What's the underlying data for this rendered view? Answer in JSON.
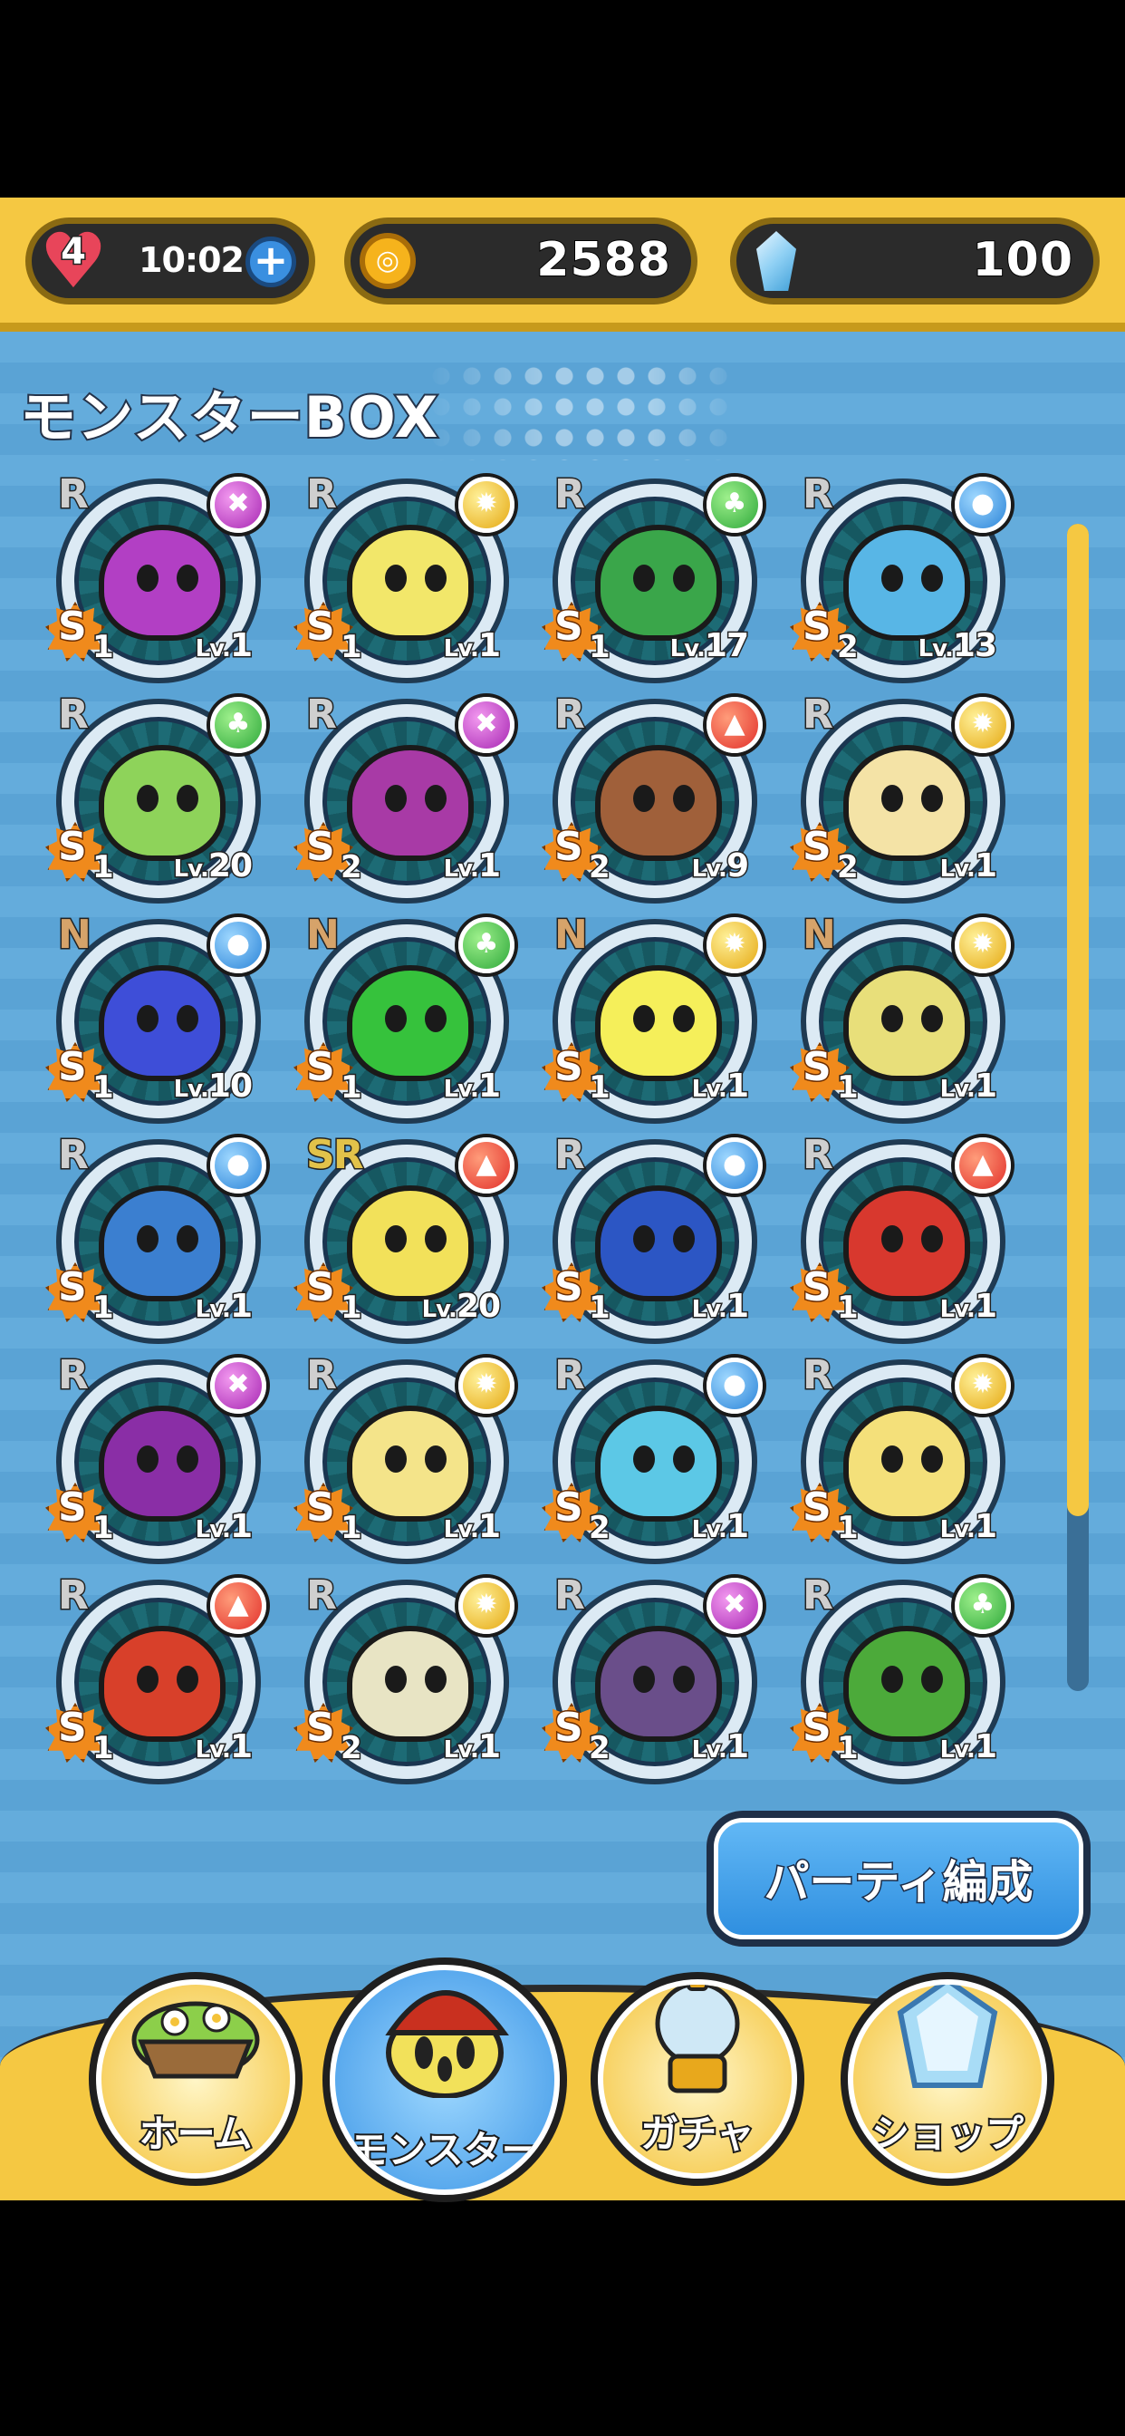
{
  "header": {
    "life_count": "4",
    "timer": "10:02",
    "coins": "2588",
    "gems": "100"
  },
  "box_title": "モンスターBOX",
  "monsters": [
    {
      "rarity": "R",
      "element": "dark",
      "stars": "1",
      "lv": "1",
      "color": "#b23fc4"
    },
    {
      "rarity": "R",
      "element": "light",
      "stars": "1",
      "lv": "1",
      "color": "#f2e76a"
    },
    {
      "rarity": "R",
      "element": "wood",
      "stars": "1",
      "lv": "17",
      "color": "#3aa64a"
    },
    {
      "rarity": "R",
      "element": "water",
      "stars": "2",
      "lv": "13",
      "color": "#58b6e6"
    },
    {
      "rarity": "R",
      "element": "wood",
      "stars": "1",
      "lv": "20",
      "color": "#8ed35a"
    },
    {
      "rarity": "R",
      "element": "dark",
      "stars": "2",
      "lv": "1",
      "color": "#a83aa6"
    },
    {
      "rarity": "R",
      "element": "fire",
      "stars": "2",
      "lv": "9",
      "color": "#a0603a"
    },
    {
      "rarity": "R",
      "element": "light",
      "stars": "2",
      "lv": "1",
      "color": "#f4e3a6"
    },
    {
      "rarity": "N",
      "element": "water",
      "stars": "1",
      "lv": "10",
      "color": "#3e4ed8"
    },
    {
      "rarity": "N",
      "element": "wood",
      "stars": "1",
      "lv": "1",
      "color": "#36c23c"
    },
    {
      "rarity": "N",
      "element": "light",
      "stars": "1",
      "lv": "1",
      "color": "#f5ef5a"
    },
    {
      "rarity": "N",
      "element": "light",
      "stars": "1",
      "lv": "1",
      "color": "#e8df7a"
    },
    {
      "rarity": "R",
      "element": "water",
      "stars": "1",
      "lv": "1",
      "color": "#3b7fd0"
    },
    {
      "rarity": "SR",
      "element": "fire",
      "stars": "1",
      "lv": "20",
      "color": "#f2e15a"
    },
    {
      "rarity": "R",
      "element": "water",
      "stars": "1",
      "lv": "1",
      "color": "#2c56c4"
    },
    {
      "rarity": "R",
      "element": "fire",
      "stars": "1",
      "lv": "1",
      "color": "#d8382e"
    },
    {
      "rarity": "R",
      "element": "dark",
      "stars": "1",
      "lv": "1",
      "color": "#8a2ea6"
    },
    {
      "rarity": "R",
      "element": "light",
      "stars": "1",
      "lv": "1",
      "color": "#f4e48a"
    },
    {
      "rarity": "R",
      "element": "water",
      "stars": "2",
      "lv": "1",
      "color": "#5cc8e6"
    },
    {
      "rarity": "R",
      "element": "light",
      "stars": "1",
      "lv": "1",
      "color": "#f4e07a"
    },
    {
      "rarity": "R",
      "element": "fire",
      "stars": "1",
      "lv": "1",
      "color": "#d8402a"
    },
    {
      "rarity": "R",
      "element": "light",
      "stars": "2",
      "lv": "1",
      "color": "#e8e4c4"
    },
    {
      "rarity": "R",
      "element": "dark",
      "stars": "2",
      "lv": "1",
      "color": "#6a4e8a"
    },
    {
      "rarity": "R",
      "element": "wood",
      "stars": "1",
      "lv": "1",
      "color": "#4caa3a"
    }
  ],
  "lv_prefix": "Lv.",
  "star_letter": "S",
  "party_button": "パーティ編成",
  "nav": {
    "home": "ホーム",
    "monster": "モンスター",
    "gacha": "ガチャ",
    "shop": "ショップ"
  },
  "colors": {
    "header": "#f5c842",
    "background": "#5aa3d5",
    "accent_blue": "#2f8fe0"
  },
  "scroll_position": 0.85
}
